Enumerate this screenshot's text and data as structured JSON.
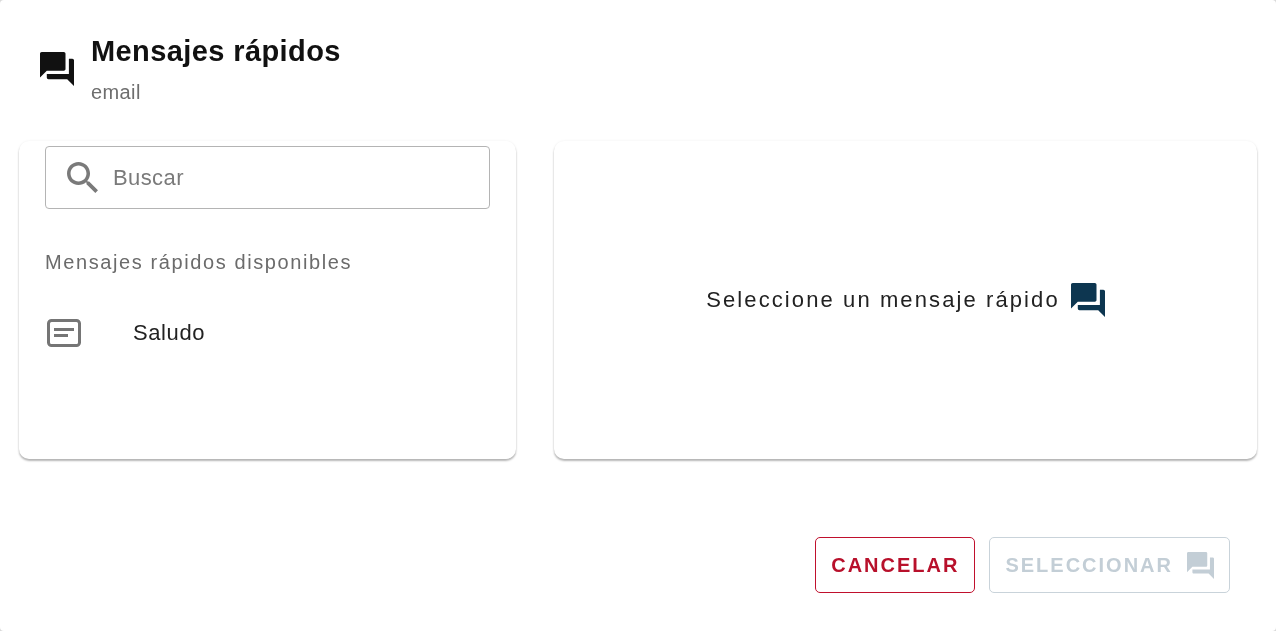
{
  "dialog": {
    "title": "Mensajes rápidos",
    "subtitle": "email"
  },
  "search": {
    "placeholder": "Buscar"
  },
  "list": {
    "heading": "Mensajes rápidos disponibles",
    "items": [
      {
        "label": "Saludo",
        "selected": false
      }
    ]
  },
  "preview": {
    "empty_message": "Seleccione un mensaje rápido"
  },
  "buttons": [
    {
      "label": "CANCELAR",
      "kind": "cancel",
      "disabled": false
    },
    {
      "label": "SELECCIONAR",
      "kind": "confirm",
      "disabled": true
    }
  ]
}
